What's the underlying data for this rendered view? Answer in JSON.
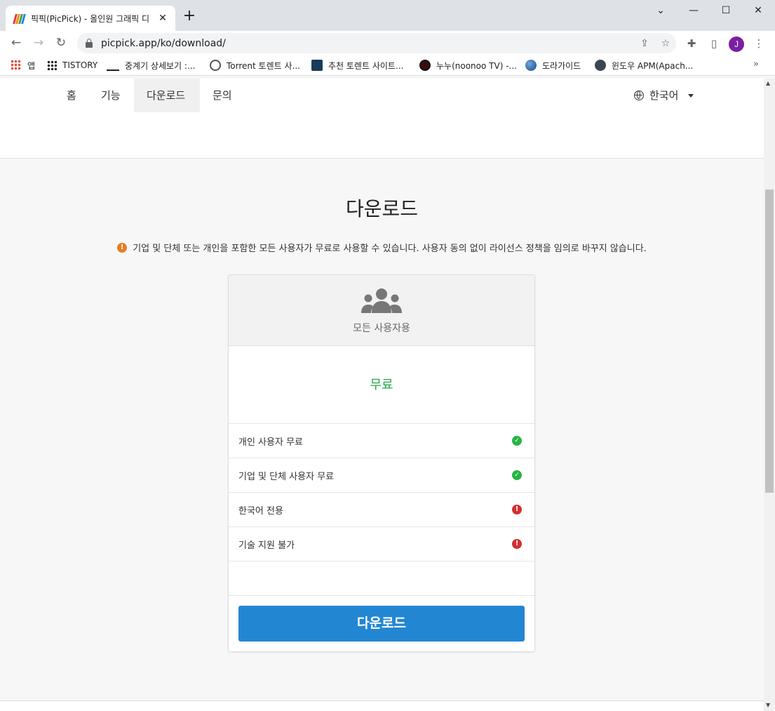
{
  "browser": {
    "tab_title": "픽픽(PicPick) - 올인원 그래픽 디",
    "tab_close": "✕",
    "new_tab": "+",
    "url": "picpick.app/ko/download/",
    "avatar_letter": "J",
    "window_controls": {
      "minimize": "⌄",
      "restore": "—",
      "maximize": "☐",
      "close": "✕"
    },
    "bookmarks": [
      {
        "label": "앱",
        "icon": "apps-grid-icon"
      },
      {
        "label": "TISTORY",
        "icon": "tistory-icon"
      },
      {
        "label": "중계기 상세보기 :...",
        "icon": "ham-icon"
      },
      {
        "label": "Torrent 토렌트 사...",
        "icon": "globe-icon"
      },
      {
        "label": "추천 토렌트 사이트...",
        "icon": "site-icon"
      },
      {
        "label": "누누(noonoo TV) -...",
        "icon": "noonoo-icon"
      },
      {
        "label": "도라가이드",
        "icon": "earth-icon"
      },
      {
        "label": "윈도우 APM(Apach...",
        "icon": "st-icon"
      }
    ],
    "bookmarks_more": "»"
  },
  "site": {
    "nav": [
      {
        "label": "홈",
        "active": false
      },
      {
        "label": "기능",
        "active": false
      },
      {
        "label": "다운로드",
        "active": true
      },
      {
        "label": "문의",
        "active": false
      }
    ],
    "language": "한국어"
  },
  "main": {
    "title": "다운로드",
    "notice": "기업 및 단체 또는 개인을 포함한 모든 사용자가 무료로 사용할 수 있습니다. 사용자 동의 없이 라이선스 정책을 임의로 바꾸지 않습니다.",
    "card": {
      "subtitle": "모든 사용자용",
      "price": "무료",
      "features": [
        {
          "label": "개인 사용자 무료",
          "status": "ok"
        },
        {
          "label": "기업 및 단체 사용자 무료",
          "status": "ok"
        },
        {
          "label": "한국어 전용",
          "status": "not-available"
        },
        {
          "label": "기술 지원 불가",
          "status": "not-available"
        }
      ],
      "download_label": "다운로드"
    }
  },
  "colors": {
    "accent": "#2386d3",
    "price_green": "#27a844",
    "ok_green": "#28b446",
    "error_red": "#d32f2f",
    "warning_orange": "#e67e22"
  }
}
